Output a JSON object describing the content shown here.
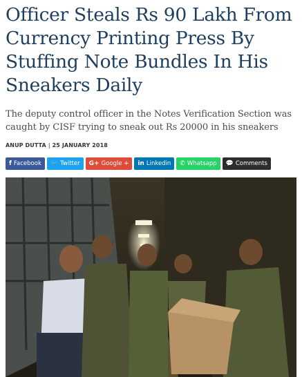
{
  "article": {
    "title": "Officer Steals Rs 90 Lakh From Currency Printing Press By Stuffing Note Bundles In His Sneakers Daily",
    "subtitle": "The deputy control officer in the Notes Verification Section was caught by CISF trying to sneak out Rs 20000 in his sneakers",
    "author": "ANUP DUTTA",
    "date": "25 JANUARY 2018",
    "byline_separator": "|"
  },
  "share": {
    "buttons": [
      {
        "label": "Facebook",
        "icon": "facebook-icon",
        "glyph": "f",
        "color": "#3b5998"
      },
      {
        "label": "Twitter",
        "icon": "twitter-icon",
        "glyph": "🐦",
        "color": "#1da1f2"
      },
      {
        "label": "Google +",
        "icon": "google-plus-icon",
        "glyph": "G+",
        "color": "#dd4b39"
      },
      {
        "label": "Linkedin",
        "icon": "linkedin-icon",
        "glyph": "in",
        "color": "#0077b5"
      },
      {
        "label": "Whatsapp",
        "icon": "whatsapp-icon",
        "glyph": "✆",
        "color": "#25d366"
      },
      {
        "label": "Comments",
        "icon": "comments-icon",
        "glyph": "💬",
        "color": "#2d2d2d"
      }
    ]
  },
  "colors": {
    "headline": "#1e3f60",
    "subtitle": "#4a4a4a"
  }
}
